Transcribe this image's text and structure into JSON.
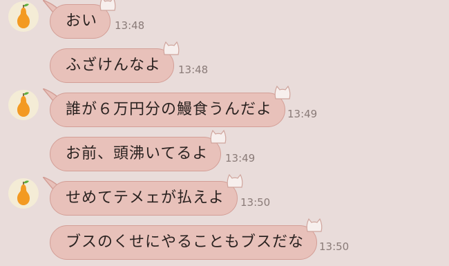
{
  "theme": {
    "background": "#e9dcda",
    "bubble": "#e8c1ba",
    "bubble_border": "#d39e96"
  },
  "messages": [
    {
      "text": "おい",
      "time": "13:48",
      "avatar": "pear-icon"
    },
    {
      "text": "ふざけんなよ",
      "time": "13:48"
    },
    {
      "text": "誰が６万円分の鰻食うんだよ",
      "time": "13:49",
      "avatar": "pear-icon"
    },
    {
      "text": "お前、頭沸いてるよ",
      "time": "13:49"
    },
    {
      "text": "せめてテメェが払えよ",
      "time": "13:50",
      "avatar": "pear-icon"
    },
    {
      "text": "ブスのくせにやることもブスだな",
      "time": "13:50"
    }
  ]
}
